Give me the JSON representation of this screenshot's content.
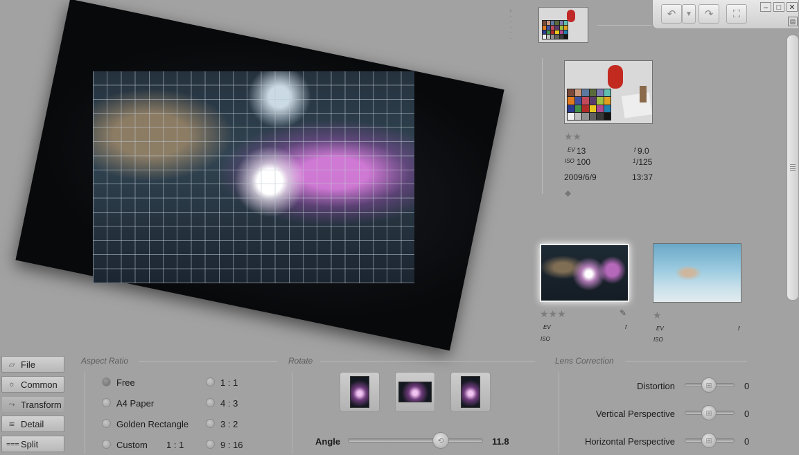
{
  "toolbar": {
    "undo_icon": "undo-icon",
    "redo_icon": "redo-icon",
    "fullscreen_icon": "fullscreen-icon"
  },
  "photo": {
    "selected": {
      "stars": "★★",
      "ev_label": "EV",
      "ev": "13",
      "iso_label": "ISO",
      "iso": "100",
      "f_label": "f",
      "aperture": "9.0",
      "shutter_num": "1",
      "shutter": "/125",
      "date": "2009/6/9",
      "time": "13:37"
    },
    "thumbs": [
      {
        "stars": "★★★",
        "ev_label": "EV",
        "iso_label": "ISO",
        "f_label": "f"
      },
      {
        "stars": "★",
        "ev_label": "EV",
        "iso_label": "ISO",
        "f_label": "f"
      }
    ]
  },
  "nav": {
    "file": "File",
    "common": "Common",
    "transform": "Transform",
    "detail": "Detail",
    "split": "Split"
  },
  "aspect_ratio": {
    "title": "Aspect Ratio",
    "options": [
      "Free",
      "A4 Paper",
      "Golden Rectangle",
      "Custom"
    ],
    "custom_value": "1 : 1",
    "ratios": [
      "1 : 1",
      "4 : 3",
      "3 : 2",
      "9 : 16"
    ],
    "selected": "Free"
  },
  "rotate": {
    "title": "Rotate",
    "angle_label": "Angle",
    "angle_value": "11.8",
    "angle": 11.8
  },
  "lens": {
    "title": "Lens Correction",
    "rows": [
      {
        "label": "Distortion",
        "value": "0"
      },
      {
        "label": "Vertical Perspective",
        "value": "0"
      },
      {
        "label": "Horizontal Perspective",
        "value": "0"
      }
    ]
  }
}
